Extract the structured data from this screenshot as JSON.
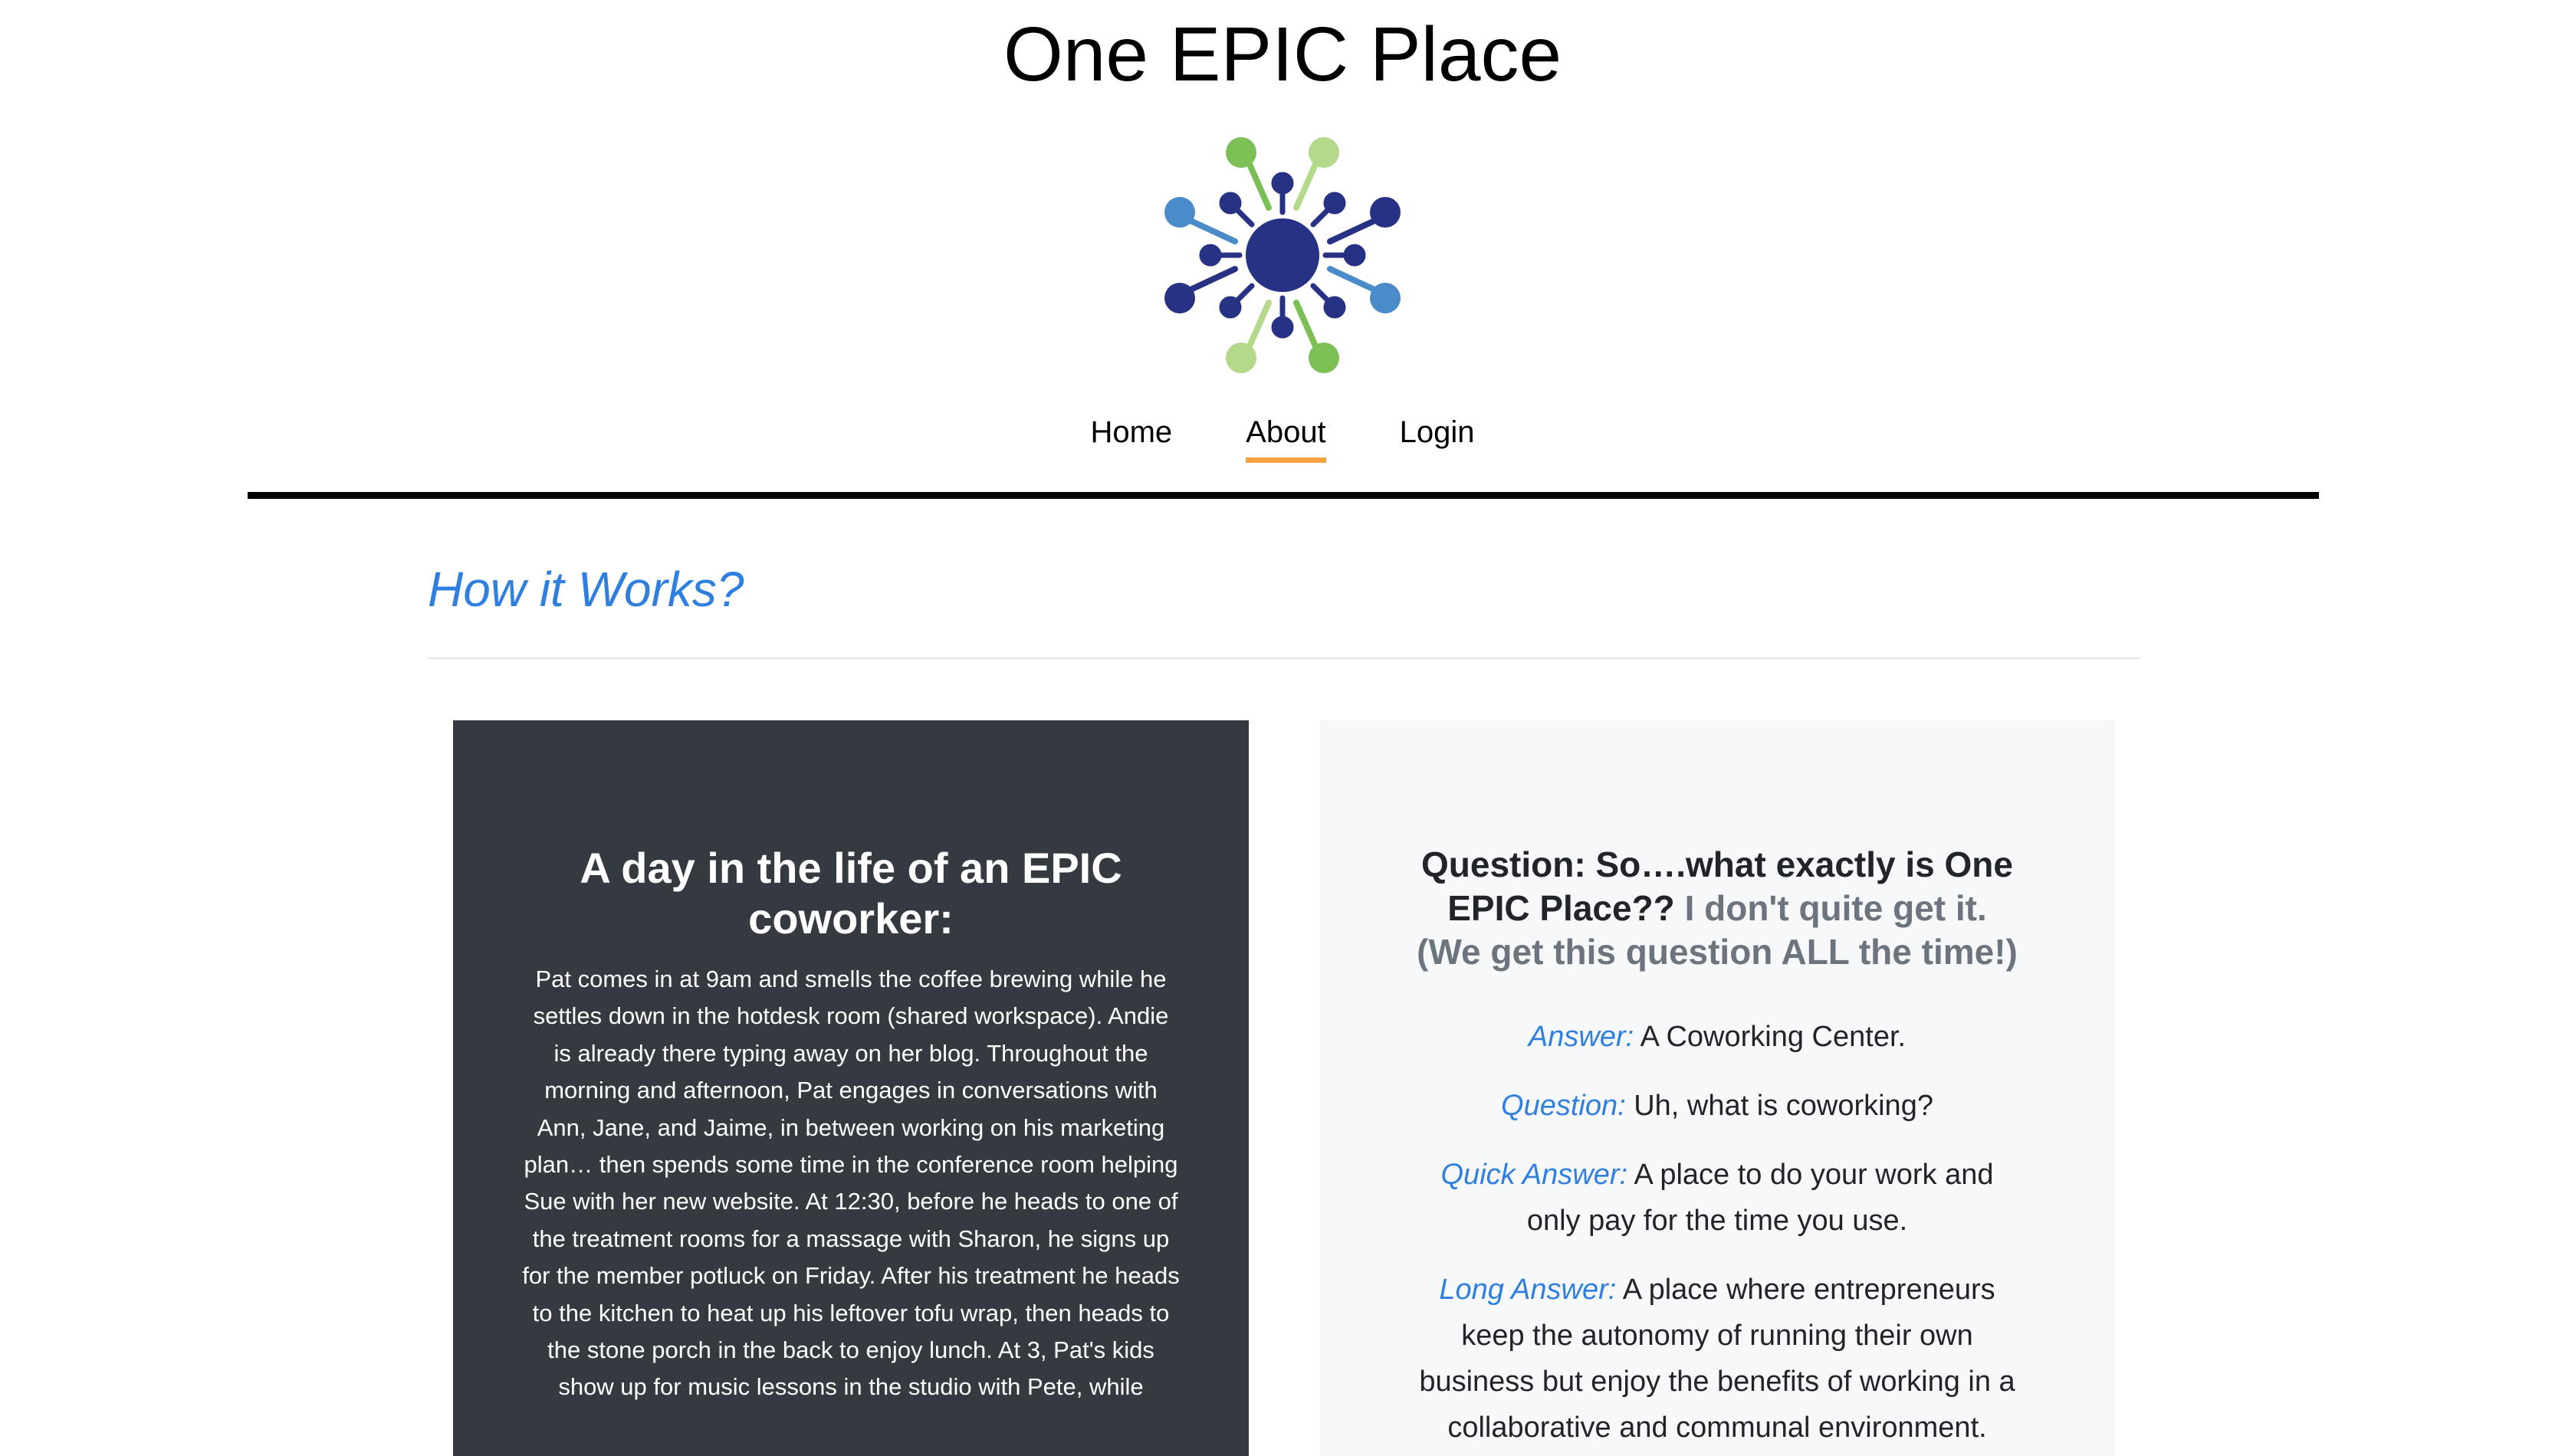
{
  "site": {
    "title": "One EPIC Place"
  },
  "colors": {
    "accent_blue": "#2f7fe0",
    "nav_underline": "#f4a340",
    "dark_card": "#343a40",
    "logo_navy": "#283284",
    "logo_green": "#7cbf55",
    "logo_light_green": "#b5d98a",
    "logo_blue": "#4a8cc9"
  },
  "nav": [
    {
      "label": "Home"
    },
    {
      "label": "About",
      "active": true
    },
    {
      "label": "Login"
    }
  ],
  "section": {
    "title": "How it Works?"
  },
  "day_card": {
    "title": "A day in the life of an EPIC coworker:",
    "body": "Pat comes in at 9am and smells the coffee brewing while he settles down in the hotdesk room (shared workspace). Andie is already there typing away on her blog. Throughout the morning and afternoon, Pat engages in conversations with Ann, Jane, and Jaime, in between working on his marketing plan… then spends some time in the conference room helping Sue with her new website. At 12:30, before he heads to one of the treatment rooms for a massage with Sharon, he signs up for the member potluck on Friday. After his treatment he heads to the kitchen to heat up his leftover tofu wrap, then heads to the stone porch in the back to enjoy lunch. At 3, Pat's kids show up for music lessons in the studio with Pete, while"
  },
  "faq_card": {
    "heading_bold": "Question: So….what exactly is One EPIC Place??",
    "heading_muted": "I don't quite get it. (We get this question ALL the time!)",
    "items": [
      {
        "label": "Answer:",
        "text": "A Coworking Center."
      },
      {
        "label": "Question:",
        "text": "Uh, what is coworking?"
      },
      {
        "label": "Quick Answer:",
        "text": "A place to do your work and only pay for the time you use."
      },
      {
        "label": "Long Answer:",
        "text": "A place where entrepreneurs keep the autonomy of running their own business but enjoy the benefits of working in a collaborative and communal environment."
      }
    ]
  }
}
